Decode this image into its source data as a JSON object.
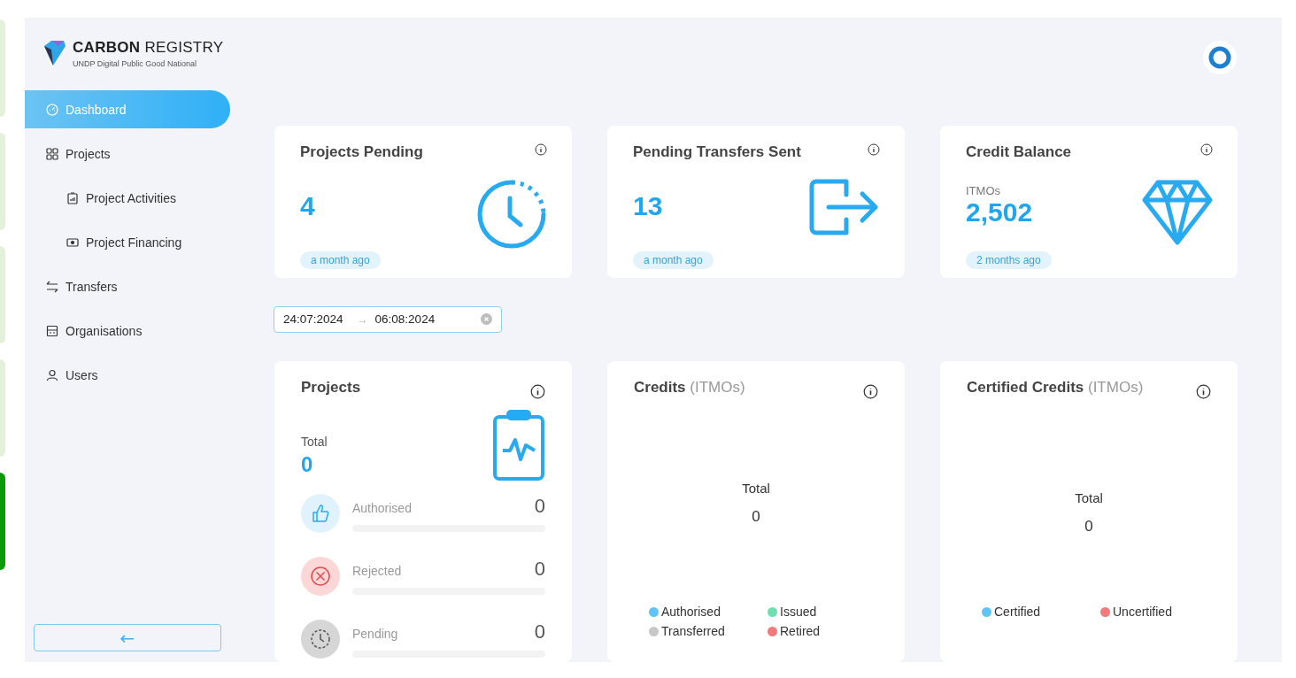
{
  "brand": {
    "name_bold": "CARBON",
    "name_light": "REGISTRY",
    "tagline": "UNDP Digital Public Good National"
  },
  "sidebar": {
    "items": [
      {
        "label": "Dashboard",
        "selected": true
      },
      {
        "label": "Projects",
        "selected": false,
        "children": [
          {
            "label": "Project Activities",
            "selected": false
          },
          {
            "label": "Project Financing",
            "selected": false
          }
        ]
      },
      {
        "label": "Transfers",
        "selected": false
      },
      {
        "label": "Organisations",
        "selected": false
      },
      {
        "label": "Users",
        "selected": false
      }
    ],
    "collapse": "←"
  },
  "stat_cards": [
    {
      "title": "Projects Pending",
      "value": "4",
      "time": "a month ago"
    },
    {
      "title": "Pending Transfers Sent",
      "value": "13",
      "time": "a month ago"
    },
    {
      "title": "Credit Balance",
      "unit": "ITMOs",
      "value": "2,502",
      "time": "2 months ago"
    }
  ],
  "date_range": {
    "start": "24:07:2024",
    "separator": "→",
    "end": "06:08:2024"
  },
  "projects_card": {
    "title": "Projects",
    "total_label": "Total",
    "total": "0",
    "statuses": [
      {
        "label": "Authorised",
        "count": "0",
        "level": 0,
        "kind": "authorised"
      },
      {
        "label": "Rejected",
        "count": "0",
        "level": 0,
        "kind": "rejected"
      },
      {
        "label": "Pending",
        "count": "0",
        "level": 0,
        "kind": "pending"
      }
    ]
  },
  "chart_cards": [
    {
      "title": "Credits",
      "unit": "(ITMOs)",
      "total_label": "Total",
      "total": "0",
      "legend": [
        {
          "label": "Authorised",
          "color": "#5ec4f7"
        },
        {
          "label": "Issued",
          "color": "#6ee0b0"
        },
        {
          "label": "Transferred",
          "color": "#c8c8c8"
        },
        {
          "label": "Retired",
          "color": "#f27a7a"
        }
      ]
    },
    {
      "title": "Certified Credits",
      "unit": "(ITMOs)",
      "total_label": "Total",
      "total": "0",
      "legend": [
        {
          "label": "Certified",
          "color": "#5ec4f7"
        },
        {
          "label": "Uncertified",
          "color": "#f27a7a"
        }
      ]
    }
  ]
}
